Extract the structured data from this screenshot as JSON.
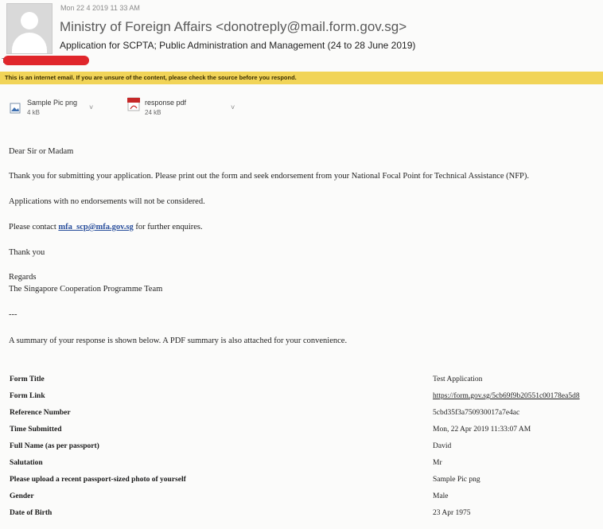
{
  "email": {
    "date": "Mon 22 4 2019 11 33 AM",
    "sender": "Ministry of Foreign Affairs <donotreply@mail.form.gov.sg>",
    "subject": "Application for SCPTA; Public Administration and Management (24 to 28 June 2019)",
    "to_prefix": "To",
    "warning": "This is an internet email. If you are unsure of the content, please check the source before you respond."
  },
  "attachments": [
    {
      "name": "Sample Pic png",
      "size": "4 kB",
      "more": "˅"
    },
    {
      "name": "response pdf",
      "size": "24 kB",
      "more": "˅"
    }
  ],
  "body": {
    "greeting": "Dear Sir or Madam",
    "para1": "Thank you for submitting your application. Please print out the form and seek endorsement from your National Focal Point for Technical Assistance (NFP).",
    "para2": "Applications with no endorsements will not be considered.",
    "para3_before": "Please contact ",
    "para3_link": "mfa_scp@mfa.gov.sg",
    "para3_after": " for further enquires.",
    "thanks": "Thank you",
    "regards": "Regards",
    "team": "The Singapore Cooperation Programme Team",
    "separator": "---",
    "summary": "A summary of your response is shown below. A PDF summary is also attached for your convenience."
  },
  "summary_table": [
    {
      "label": "Form Title",
      "value": "Test Application"
    },
    {
      "label": "Form Link",
      "value": "https://form.gov.sg/5cb69f9b20551c00178ea5d8"
    },
    {
      "label": "Reference Number",
      "value": "5cbd35f3a750930017a7e4ac"
    },
    {
      "label": "Time Submitted",
      "value": "Mon, 22 Apr 2019 11:33:07 AM"
    },
    {
      "label": "Full Name (as per passport)",
      "value": "David"
    },
    {
      "label": "Salutation",
      "value": "Mr"
    },
    {
      "label": "Please upload a recent passport-sized photo of yourself",
      "value": "Sample Pic png"
    },
    {
      "label": "Gender",
      "value": "Male"
    },
    {
      "label": "Date of Birth",
      "value": "23 Apr 1975"
    }
  ],
  "colors": {
    "banner": "#f1d458",
    "redaction": "#e0262b",
    "link": "#2a4f9c"
  }
}
